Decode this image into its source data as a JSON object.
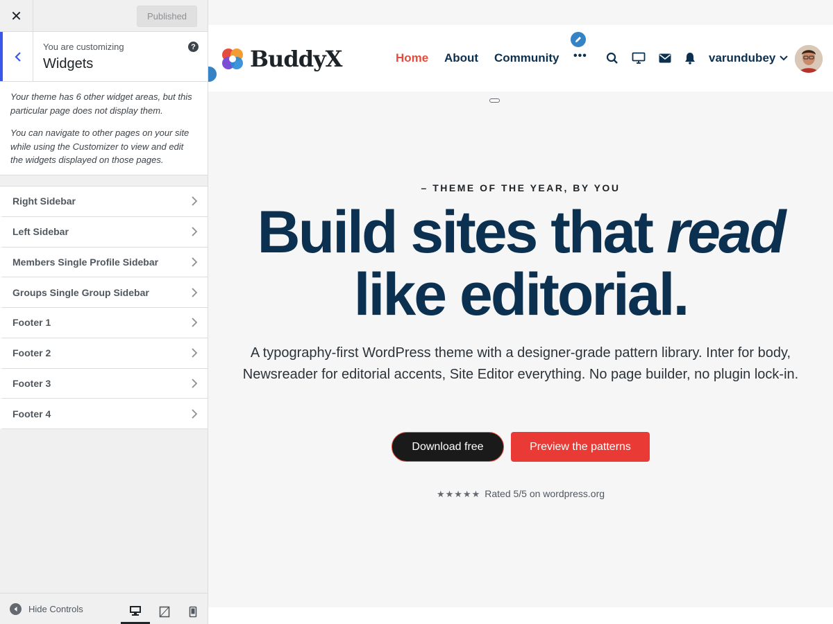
{
  "panel": {
    "close_glyph": "✕",
    "published_label": "Published",
    "customizing_label": "You are customizing",
    "section_name": "Widgets",
    "help_glyph": "?",
    "notice": [
      "Your theme has 6 other widget areas, but this particular page does not display them.",
      "You can navigate to other pages on your site while using the Customizer to view and edit the widgets displayed on those pages."
    ],
    "widget_areas": [
      "Right Sidebar",
      "Left Sidebar",
      "Members Single Profile Sidebar",
      "Groups Single Group Sidebar",
      "Footer 1",
      "Footer 2",
      "Footer 3",
      "Footer 4"
    ],
    "footer": {
      "hide_controls_label": "Hide Controls",
      "active_device": "desktop"
    },
    "accent_color": "#3858e9"
  },
  "site": {
    "logo_text": "BuddyX",
    "nav": {
      "home": "Home",
      "about": "About",
      "community": "Community",
      "more": "•••"
    },
    "username": "varundubey",
    "icons": [
      "search-icon",
      "monitor-icon",
      "mail-icon",
      "bell-icon"
    ],
    "hero": {
      "eyebrow": "– THEME OF THE YEAR, BY YOU",
      "headline_part1": "Build sites that ",
      "headline_italic": "read",
      "headline_part2": "like editorial.",
      "lede": "A typography-first WordPress theme with a designer-grade pattern library. Inter for body, Newsreader for editorial accents, Site Editor everything. No page builder, no plugin lock-in.",
      "primary_button": "Download free",
      "secondary_button": "Preview the patterns",
      "stars": "★★★★★",
      "rating_text": "Rated 5/5 on wordpress.org"
    },
    "colors": {
      "navy": "#0c3050",
      "accent_red": "#e54c3c",
      "button_red": "#e93a35"
    }
  }
}
